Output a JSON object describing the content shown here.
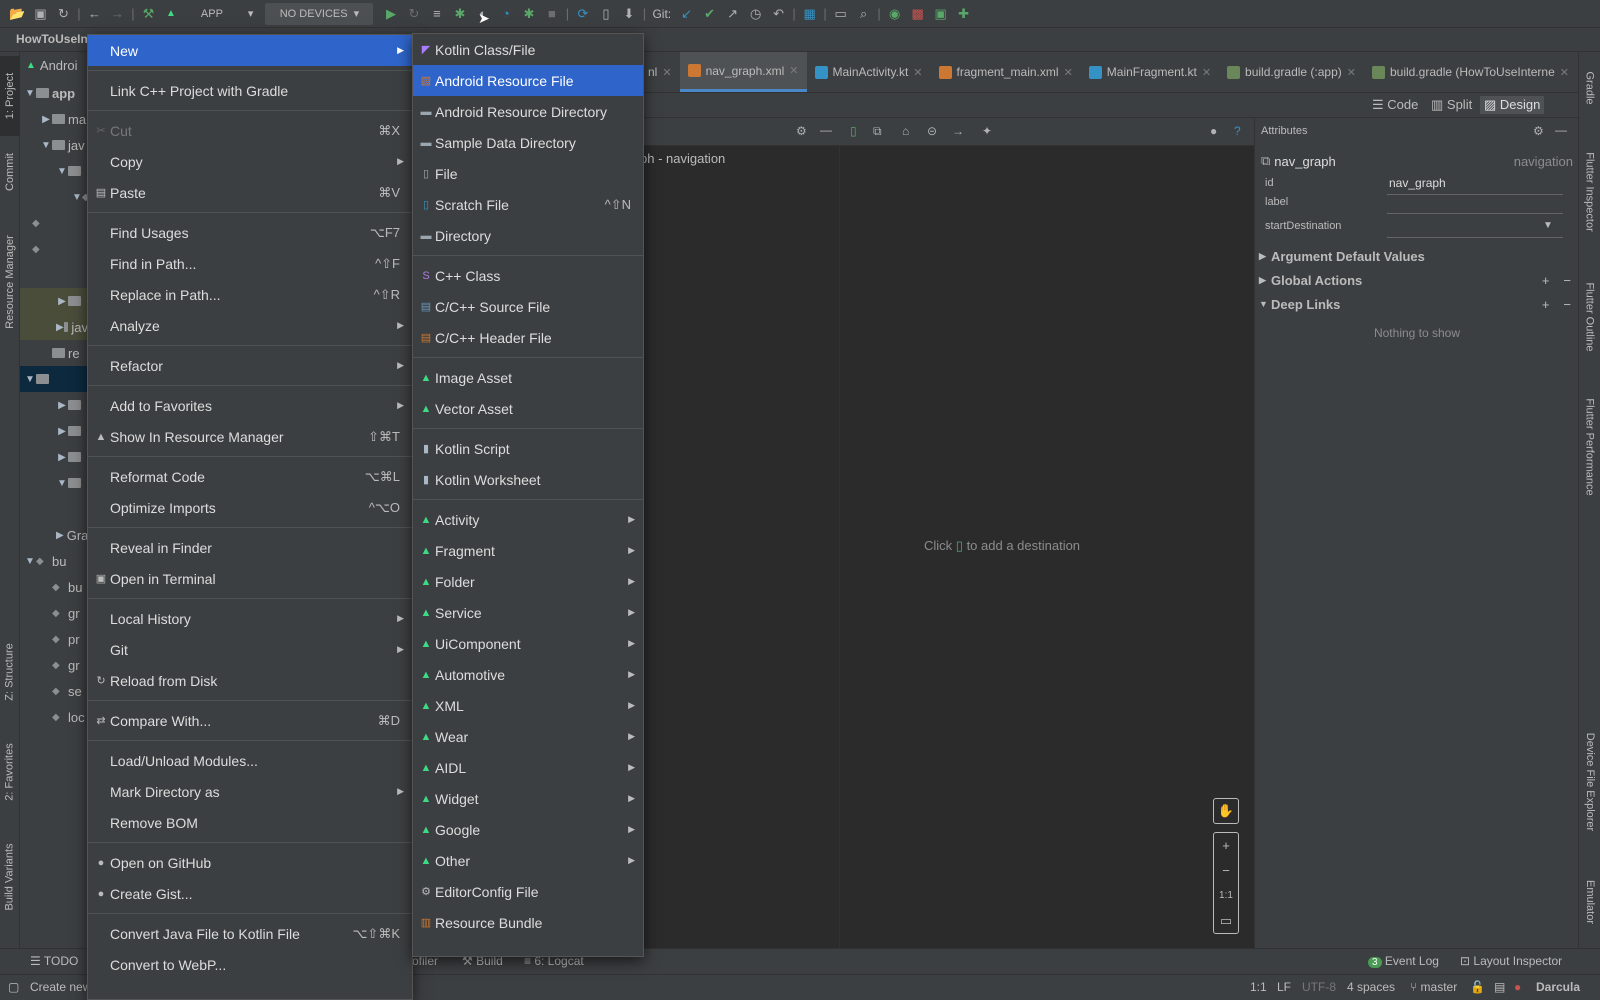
{
  "toolbar": {
    "run_config": "APP",
    "devices": "NO DEVICES",
    "git_label": "Git:"
  },
  "title_fragment": "HowToUseIn",
  "left_tabs": [
    "1: Project",
    "Commit",
    "Resource Manager",
    "Z: Structure",
    "2: Favorites",
    "Build Variants"
  ],
  "right_tabs": [
    "Gradle",
    "Flutter Inspector",
    "Flutter Outline",
    "Flutter Performance",
    "Device File Explorer",
    "Emulator"
  ],
  "project_tree": {
    "header": "Androi",
    "rows": [
      "app",
      "ma",
      "jav",
      "",
      "",
      "",
      "",
      "",
      "jav",
      "re",
      "",
      "",
      "",
      "",
      "",
      "Grad",
      "bu",
      "bu",
      "gr",
      "pr",
      "gr",
      "se",
      "loc"
    ]
  },
  "editor_tabs": [
    {
      "label": "nl",
      "active": false
    },
    {
      "label": "nav_graph.xml",
      "active": true
    },
    {
      "label": "MainActivity.kt",
      "active": false
    },
    {
      "label": "fragment_main.xml",
      "active": false
    },
    {
      "label": "MainFragment.kt",
      "active": false
    },
    {
      "label": "build.gradle (:app)",
      "active": false
    },
    {
      "label": "build.gradle (HowToUseInterne",
      "active": false
    }
  ],
  "view_modes": {
    "code": "Code",
    "split": "Split",
    "design": "Design"
  },
  "nav_left_host": "ph - navigation",
  "canvas_hint": {
    "before": "Click",
    "after": "to add a destination"
  },
  "zoom_fit": "1:1",
  "attributes": {
    "title": "Attributes",
    "element": "nav_graph",
    "element_type": "navigation",
    "fields": [
      {
        "label": "id",
        "value": "nav_graph"
      },
      {
        "label": "label",
        "value": ""
      },
      {
        "label": "startDestination",
        "value": ""
      }
    ],
    "sections": [
      "Argument Default Values",
      "Global Actions",
      "Deep Links"
    ],
    "empty": "Nothing to show"
  },
  "context_menu": [
    {
      "label": "New",
      "submenu": true,
      "highlight": true
    },
    {
      "sep": true
    },
    {
      "label": "Link C++ Project with Gradle"
    },
    {
      "sep": true
    },
    {
      "label": "Cut",
      "shortcut": "⌘X",
      "disabled": true,
      "icon": "✂"
    },
    {
      "label": "Copy",
      "submenu": true
    },
    {
      "label": "Paste",
      "shortcut": "⌘V",
      "icon": "▤"
    },
    {
      "sep": true
    },
    {
      "label": "Find Usages",
      "shortcut": "⌥F7"
    },
    {
      "label": "Find in Path...",
      "shortcut": "^⇧F"
    },
    {
      "label": "Replace in Path...",
      "shortcut": "^⇧R"
    },
    {
      "label": "Analyze",
      "submenu": true
    },
    {
      "sep": true
    },
    {
      "label": "Refactor",
      "submenu": true
    },
    {
      "sep": true
    },
    {
      "label": "Add to Favorites",
      "submenu": true
    },
    {
      "label": "Show In Resource Manager",
      "shortcut": "⇧⌘T",
      "icon": "▲"
    },
    {
      "sep": true
    },
    {
      "label": "Reformat Code",
      "shortcut": "⌥⌘L"
    },
    {
      "label": "Optimize Imports",
      "shortcut": "^⌥O"
    },
    {
      "sep": true
    },
    {
      "label": "Reveal in Finder"
    },
    {
      "label": "Open in Terminal",
      "icon": "▣"
    },
    {
      "sep": true
    },
    {
      "label": "Local History",
      "submenu": true
    },
    {
      "label": "Git",
      "submenu": true
    },
    {
      "label": "Reload from Disk",
      "icon": "↻"
    },
    {
      "sep": true
    },
    {
      "label": "Compare With...",
      "shortcut": "⌘D",
      "icon": "⇄"
    },
    {
      "sep": true
    },
    {
      "label": "Load/Unload Modules..."
    },
    {
      "label": "Mark Directory as",
      "submenu": true
    },
    {
      "label": "Remove BOM"
    },
    {
      "sep": true
    },
    {
      "label": "Open on GitHub",
      "icon": "●"
    },
    {
      "label": "Create Gist...",
      "icon": "●"
    },
    {
      "sep": true
    },
    {
      "label": "Convert Java File to Kotlin File",
      "shortcut": "⌥⇧⌘K"
    },
    {
      "label": "Convert to WebP..."
    }
  ],
  "new_submenu": [
    {
      "label": "Kotlin Class/File",
      "icon": "kotlin"
    },
    {
      "label": "Android Resource File",
      "icon": "res",
      "highlight": true
    },
    {
      "label": "Android Resource Directory",
      "icon": "folder"
    },
    {
      "label": "Sample Data Directory",
      "icon": "folder"
    },
    {
      "label": "File",
      "icon": "file"
    },
    {
      "label": "Scratch File",
      "icon": "scratch",
      "shortcut": "^⇧N"
    },
    {
      "label": "Directory",
      "icon": "folder"
    },
    {
      "sep": true
    },
    {
      "label": "C++ Class",
      "icon": "cpp"
    },
    {
      "label": "C/C++ Source File",
      "icon": "cppsrc"
    },
    {
      "label": "C/C++ Header File",
      "icon": "cpphdr"
    },
    {
      "sep": true
    },
    {
      "label": "Image Asset",
      "icon": "android"
    },
    {
      "label": "Vector Asset",
      "icon": "android"
    },
    {
      "sep": true
    },
    {
      "label": "Kotlin Script",
      "icon": "kts"
    },
    {
      "label": "Kotlin Worksheet",
      "icon": "kts"
    },
    {
      "sep": true
    },
    {
      "label": "Activity",
      "icon": "android",
      "submenu": true
    },
    {
      "label": "Fragment",
      "icon": "android",
      "submenu": true
    },
    {
      "label": "Folder",
      "icon": "android",
      "submenu": true
    },
    {
      "label": "Service",
      "icon": "android",
      "submenu": true
    },
    {
      "label": "UiComponent",
      "icon": "android",
      "submenu": true
    },
    {
      "label": "Automotive",
      "icon": "android",
      "submenu": true
    },
    {
      "label": "XML",
      "icon": "android",
      "submenu": true
    },
    {
      "label": "Wear",
      "icon": "android",
      "submenu": true
    },
    {
      "label": "AIDL",
      "icon": "android",
      "submenu": true
    },
    {
      "label": "Widget",
      "icon": "android",
      "submenu": true
    },
    {
      "label": "Google",
      "icon": "android",
      "submenu": true
    },
    {
      "label": "Other",
      "icon": "android",
      "submenu": true
    },
    {
      "label": "EditorConfig File",
      "icon": "gear"
    },
    {
      "label": "Resource Bundle",
      "icon": "bundle"
    }
  ],
  "bottom_tools": {
    "todo": "TODO",
    "profiler": "ofiler",
    "build": "Build",
    "logcat": "6: Logcat",
    "event_log": "Event Log",
    "event_count": "3",
    "layout_inspector": "Layout Inspector"
  },
  "status": {
    "left": "Create new",
    "pos": "1:1",
    "lf": "LF",
    "encoding": "UTF-8",
    "indent": "4 spaces",
    "branch": "master",
    "theme": "Darcula"
  }
}
